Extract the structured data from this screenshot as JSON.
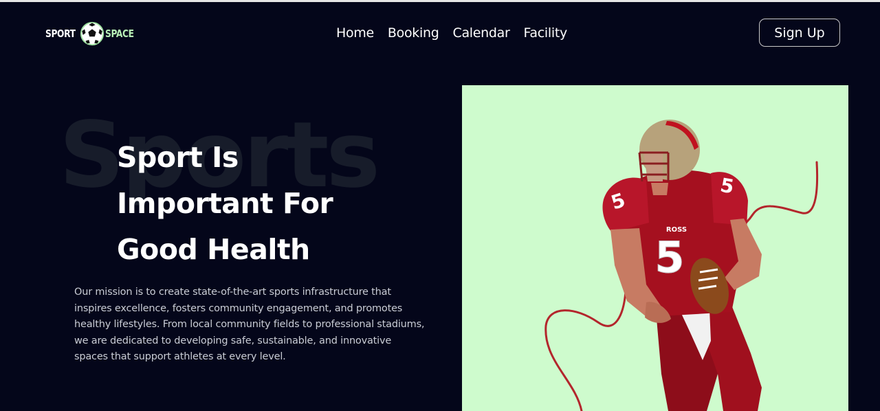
{
  "brand": {
    "left": "SPORT",
    "right": "SPACE"
  },
  "nav": {
    "links": [
      "Home",
      "Booking",
      "Calendar",
      "Facility"
    ],
    "signup_label": "Sign Up"
  },
  "hero": {
    "background_word": "Sports",
    "title_lines": [
      "Sport Is",
      "Important For",
      "Good Health"
    ],
    "description": "Our mission is to create state-of-the-art sports infrastructure that inspires excellence, fosters community engagement, and promotes healthy lifestyles. From local community fields to professional stadiums, we are dedicated to developing safe, sustainable, and innovative spaces that support athletes at every level.",
    "jersey_number": "5",
    "jersey_name": "ROSS",
    "image_subject": "football-player"
  },
  "colors": {
    "background": "#04061a",
    "accent_green": "#cefbcd",
    "logo_green": "#b7efb6",
    "jersey_red": "#a5101f",
    "rope_red": "#b3262c"
  }
}
